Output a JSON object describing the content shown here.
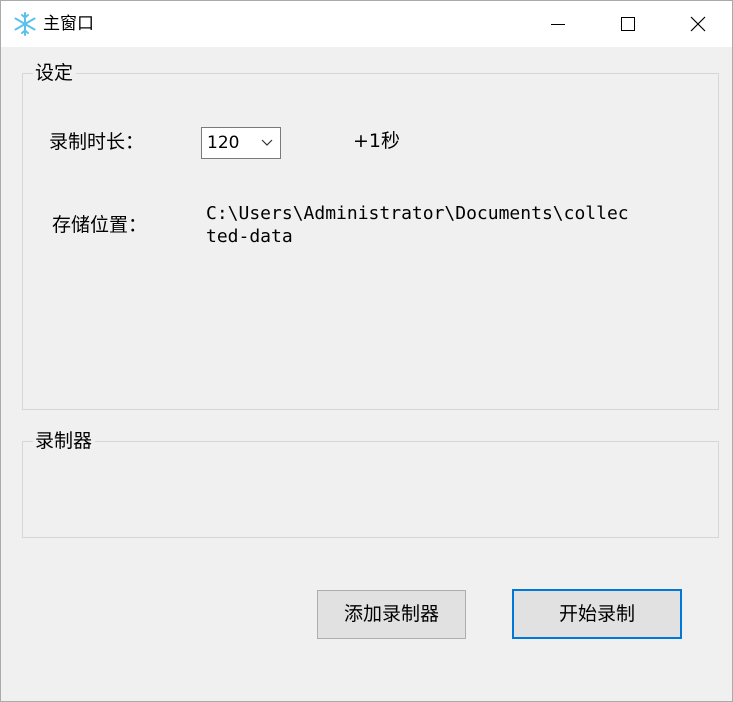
{
  "window": {
    "title": "主窗口",
    "icon": "snowflake-icon"
  },
  "titlebar_buttons": {
    "minimize": "minimize-icon",
    "maximize": "maximize-icon",
    "close": "close-icon"
  },
  "settings": {
    "legend": "设定",
    "duration_label": "录制时长：",
    "duration_value": "120",
    "duration_extra": "+1秒",
    "storage_label": "存储位置：",
    "storage_path_line1": "C:\\Users\\Administrator\\Documents\\collec",
    "storage_path_line2": "ted-data"
  },
  "recorders": {
    "legend": "录制器"
  },
  "actions": {
    "add_recorder": "添加录制器",
    "start_recording": "开始录制"
  },
  "colors": {
    "accent": "#0078d7",
    "icon": "#5bc0eb"
  }
}
